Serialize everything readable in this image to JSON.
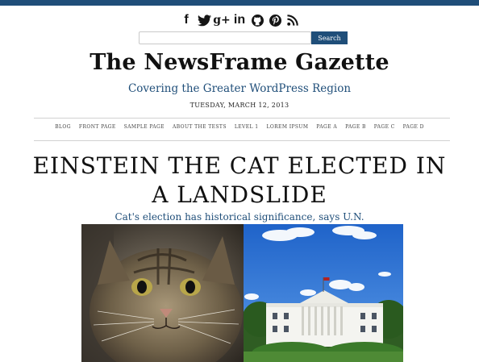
{
  "site": {
    "title": "The NewsFrame Gazette",
    "tagline": "Covering the Greater WordPress Region",
    "date": "TUESDAY, MARCH 12, 2013",
    "accent_color": "#1f4e79"
  },
  "social": {
    "facebook": "f",
    "googleplus": "g+",
    "linkedin": "in"
  },
  "search": {
    "button_label": "Search",
    "placeholder": ""
  },
  "nav": {
    "items": [
      "BLOG",
      "FRONT PAGE",
      "SAMPLE PAGE",
      "ABOUT THE TESTS",
      "LEVEL 1",
      "LOREM IPSUM",
      "PAGE A",
      "PAGE B",
      "PAGE C",
      "PAGE D"
    ]
  },
  "article": {
    "headline": "EINSTEIN THE CAT ELECTED IN A LANDSLIDE",
    "subheadline": "Cat's election has historical significance, says U.N."
  }
}
